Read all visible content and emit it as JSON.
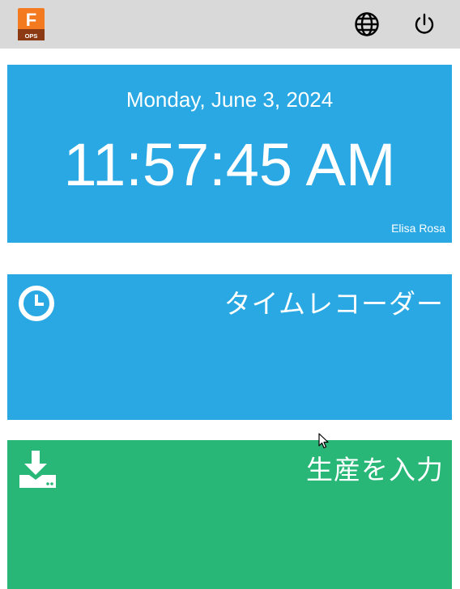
{
  "header": {
    "logo_letter": "F",
    "logo_caption": "OPS",
    "logo_color": "#f26a1b",
    "globe_icon": "globe-icon",
    "power_icon": "power-icon"
  },
  "clock": {
    "date": "Monday, June 3, 2024",
    "time": "11:57:45 AM",
    "user": "Elisa Rosa",
    "bg_color": "#29a8e3"
  },
  "tiles": [
    {
      "label": "タイムレコーダー",
      "icon": "clock-icon",
      "color": "#29a8e3"
    },
    {
      "label": "生産を入力",
      "icon": "download-icon",
      "color": "#28b777"
    }
  ]
}
